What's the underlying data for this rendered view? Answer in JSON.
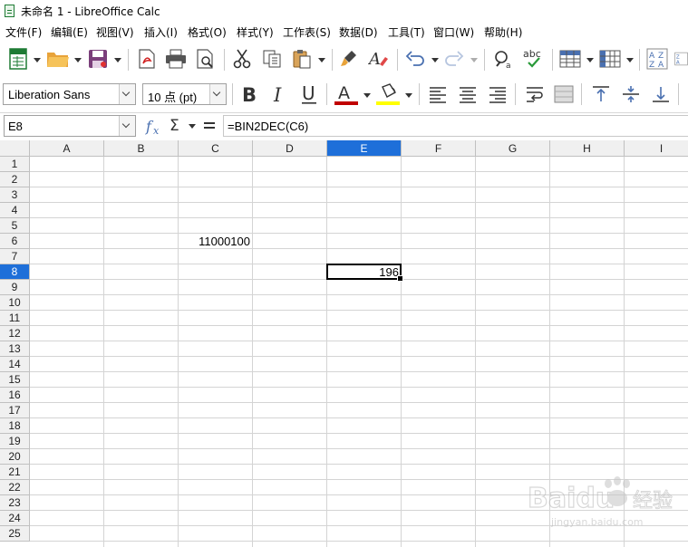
{
  "window": {
    "title": "未命名 1 - LibreOffice Calc"
  },
  "menu": [
    "文件(F)",
    "编辑(E)",
    "视图(V)",
    "插入(I)",
    "格式(O)",
    "样式(Y)",
    "工作表(S)",
    "数据(D)",
    "工具(T)",
    "窗口(W)",
    "帮助(H)"
  ],
  "format_bar": {
    "font_name": "Liberation Sans",
    "font_size": "10 点 (pt)"
  },
  "formula_bar": {
    "cell_ref": "E8",
    "formula": "=BIN2DEC(C6)"
  },
  "sheet": {
    "columns": [
      "A",
      "B",
      "C",
      "D",
      "E",
      "F",
      "G",
      "H",
      "I"
    ],
    "rows": [
      "1",
      "2",
      "3",
      "4",
      "5",
      "6",
      "7",
      "8",
      "9",
      "10",
      "11",
      "12",
      "13",
      "14",
      "15",
      "16",
      "17",
      "18",
      "19",
      "20",
      "21",
      "22",
      "23",
      "24",
      "25"
    ],
    "selected_column": "E",
    "selected_row": "8",
    "cells": {
      "C6": "11000100",
      "E8": "196"
    }
  },
  "watermark": {
    "brand": "Baidu",
    "sub": "经验",
    "url": "jingyan.baidu.com"
  },
  "colors": {
    "selection": "#1e6fd9",
    "font_color": "#c00000",
    "highlight": "#ffff00"
  }
}
